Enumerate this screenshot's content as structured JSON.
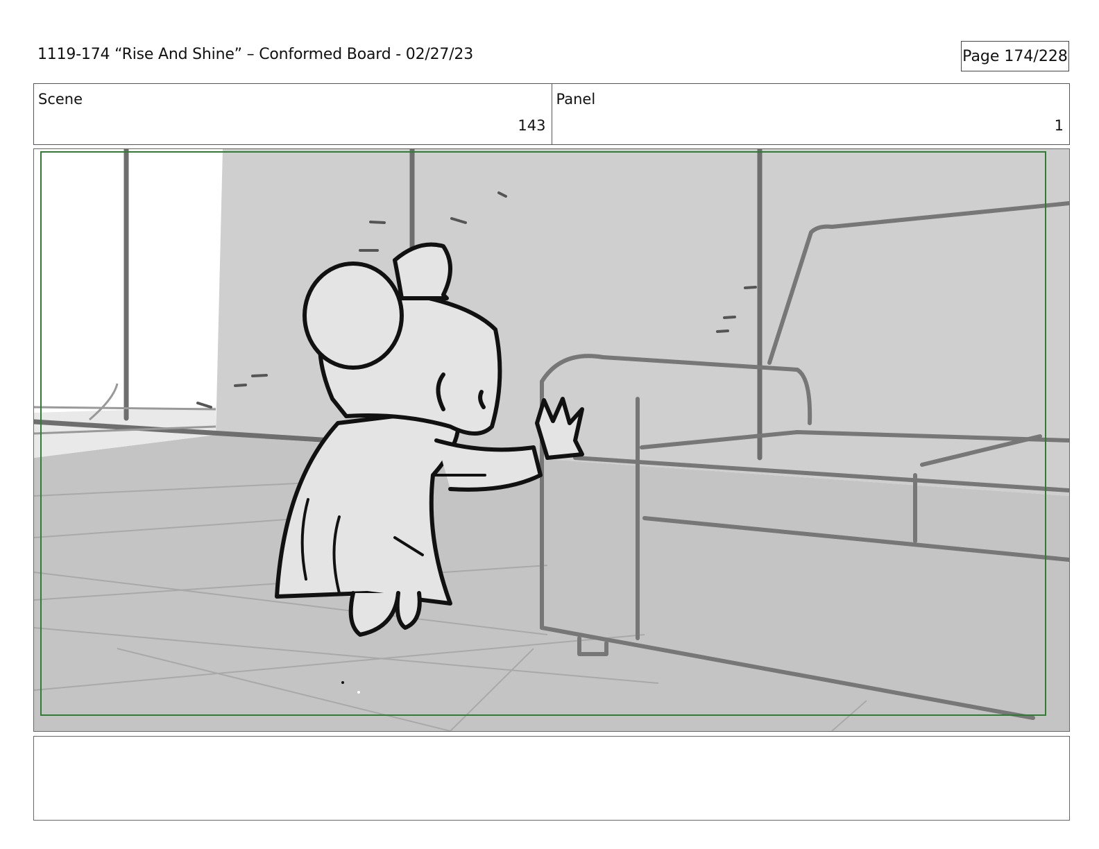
{
  "header": {
    "title": "1119-174 “Rise And Shine” – Conformed Board - 02/27/23",
    "page_label": "Page 174/228"
  },
  "info": {
    "scene_label": "Scene",
    "scene_value": "143",
    "panel_label": "Panel",
    "panel_value": "1"
  },
  "colors": {
    "safe_frame": "#2e7d32",
    "wall_gray": "#cfcfcf",
    "floor_gray": "#c4c4c4",
    "character_fill": "#e4e4e4",
    "line_dark": "#111111"
  },
  "notes": {
    "text": ""
  }
}
